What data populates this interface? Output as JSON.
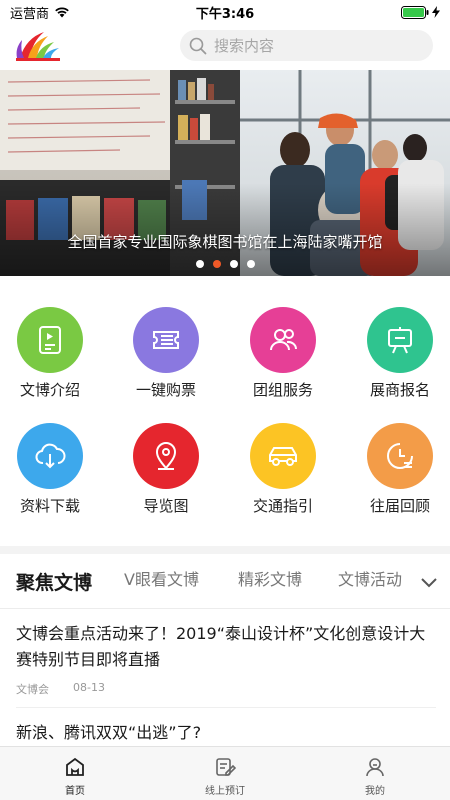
{
  "status_bar": {
    "carrier": "运营商",
    "time": "下午3:46"
  },
  "header": {
    "logo_icon": "logo-icon",
    "search_placeholder": "搜索内容"
  },
  "banner": {
    "caption": "全国首家专业国际象棋图书馆在上海陆家嘴开馆",
    "slide_count": 4,
    "active_slide": 2,
    "accent": "#f05a28"
  },
  "grid": [
    {
      "label": "文博介绍",
      "icon": "video-book-icon",
      "color": "#7ac943"
    },
    {
      "label": "一键购票",
      "icon": "ticket-icon",
      "color": "#8a78e0"
    },
    {
      "label": "团组服务",
      "icon": "group-icon",
      "color": "#e63f96"
    },
    {
      "label": "展商报名",
      "icon": "exhibit-board-icon",
      "color": "#2fc48f"
    },
    {
      "label": "资料下载",
      "icon": "cloud-download-icon",
      "color": "#3da8ec"
    },
    {
      "label": "导览图",
      "icon": "location-pin-icon",
      "color": "#e5262e"
    },
    {
      "label": "交通指引",
      "icon": "car-icon",
      "color": "#fcc424"
    },
    {
      "label": "往届回顾",
      "icon": "history-icon",
      "color": "#f39c48"
    }
  ],
  "tabs": [
    "聚焦文博",
    "V眼看文博",
    "精彩文博",
    "文博活动"
  ],
  "news": [
    {
      "title": "文博会重点活动来了！2019“泰山设计杯”文化创意设计大赛特别节目即将直播",
      "source": "文博会",
      "date": "08-13"
    },
    {
      "title": "新浪、腾讯双双“出逃”了?"
    }
  ],
  "bottom_nav": [
    {
      "label": "首页",
      "icon": "home-icon"
    },
    {
      "label": "线上预订",
      "icon": "edit-booking-icon"
    },
    {
      "label": "我的",
      "icon": "profile-icon"
    }
  ]
}
